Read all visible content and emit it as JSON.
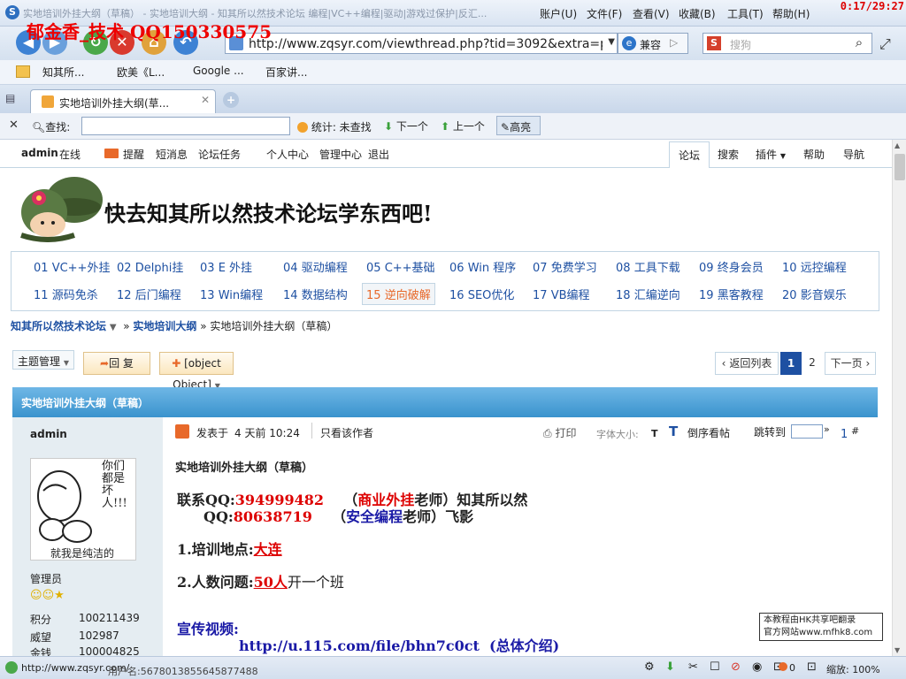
{
  "browser": {
    "title": "实地培训外挂大纲（草稿） - 实地培训大纲 - 知其所以然技术论坛 编程|VC++编程|驱动|游戏过保护|反汇...",
    "menu": [
      "账户(U)",
      "文件(F)",
      "查看(V)",
      "收藏(B)",
      "工具(T)",
      "帮助(H)"
    ],
    "clock": "0:17/29:27",
    "overlay_text": "郁金香_技术 QQ150330575",
    "url": "http://www.zqsyr.com/viewthread.php?tid=3092&extra=pag",
    "compat_label": "兼容",
    "search_placeholder": "搜狗",
    "favorites": [
      "知其所...",
      "欧美《L...",
      "Google ...",
      "百家讲..."
    ],
    "tab_title": "实地培训外挂大纲(草...",
    "find": {
      "label": "查找:",
      "stat": "统计: 未查找",
      "next": "下一个",
      "prev": "上一个",
      "highlight": "高亮"
    },
    "status": {
      "url": "http://www.zqsyr.com/",
      "overlap_text": "用户名:5678013855645877488",
      "count": "0",
      "zoom": "缩放: 100%"
    }
  },
  "forum": {
    "user": "admin",
    "online": "在线",
    "toplinks": [
      "提醒",
      "短消息",
      "论坛任务",
      "个人中心",
      "管理中心",
      "退出"
    ],
    "righttabs": [
      "论坛",
      "搜索",
      "插件",
      "帮助",
      "导航"
    ],
    "banner": "快去知其所以然技术论坛学东西吧!",
    "categories": [
      {
        "no": "01",
        "name": "VC++外挂"
      },
      {
        "no": "02",
        "name": "Delphi挂"
      },
      {
        "no": "03",
        "name": "E 外挂"
      },
      {
        "no": "04",
        "name": "驱动编程"
      },
      {
        "no": "05",
        "name": "C++基础"
      },
      {
        "no": "06",
        "name": "Win 程序"
      },
      {
        "no": "07",
        "name": "免费学习"
      },
      {
        "no": "08",
        "name": "工具下载"
      },
      {
        "no": "09",
        "name": "终身会员"
      },
      {
        "no": "10",
        "name": "远控编程"
      },
      {
        "no": "11",
        "name": "源码免杀"
      },
      {
        "no": "12",
        "name": "后门编程"
      },
      {
        "no": "13",
        "name": "Win编程"
      },
      {
        "no": "14",
        "name": "数据结构"
      },
      {
        "no": "15",
        "name": "逆向破解"
      },
      {
        "no": "16",
        "name": "SEO优化"
      },
      {
        "no": "17",
        "name": "VB编程"
      },
      {
        "no": "18",
        "name": "汇编逆向"
      },
      {
        "no": "19",
        "name": "黑客教程"
      },
      {
        "no": "20",
        "name": "影音娱乐"
      }
    ],
    "breadcrumb": [
      "知其所以然技术论坛",
      "»",
      "实地培训大纲",
      "»",
      "实地培训外挂大纲（草稿）"
    ],
    "manage": "主题管理",
    "reply": "回 复",
    "post": {
      "heading": "实地培训外挂大纲（草稿）",
      "l1_label": "联系QQ:",
      "l1_qq": "394999482",
      "l1_p1": "（",
      "l1_role": "商业外挂",
      "l1_p2": "老师）知其所以然",
      "l2_label": "QQ:",
      "l2_qq": "80638719",
      "l2_p1": "（",
      "l2_role": "安全编程",
      "l2_p2": "老师）飞影",
      "l3_label": "1.培训地点:",
      "l3_val": "大连",
      "l4_label": "2.人数问题:",
      "l4_val": "50人",
      "l4_rest": "开一个班",
      "l5_label": "宣传视频:",
      "l5_url": "http://u.115.com/file/bhn7c0ct",
      "l5_note": "(总体介绍)"
    },
    "back": "返回列表",
    "pages": [
      "1",
      "2"
    ],
    "next_page": "下一页",
    "thread_title": "实地培训外挂大纲（草稿）",
    "author": {
      "name": "admin",
      "avatar_text": "你们都是坏人!!!",
      "avatar_caption": "就我是纯洁的",
      "role": "管理员",
      "stats": [
        {
          "k": "积分",
          "v": "100211439"
        },
        {
          "k": "威望",
          "v": "102987"
        },
        {
          "k": "金钱",
          "v": "100004825"
        }
      ]
    },
    "post_meta": {
      "posted": "发表于",
      "time": "4 天前 10:24",
      "only_author": "只看该作者",
      "print": "打印",
      "fontsize": "字体大小:",
      "t1": "T",
      "t2": "T",
      "reverse": "倒序看帖",
      "jump": "跳转到",
      "floor": "1",
      "hash": "#"
    },
    "hk_line1": "本教程由HK共享吧翻录",
    "hk_line2": "官方网站www.mfhk8.com"
  }
}
